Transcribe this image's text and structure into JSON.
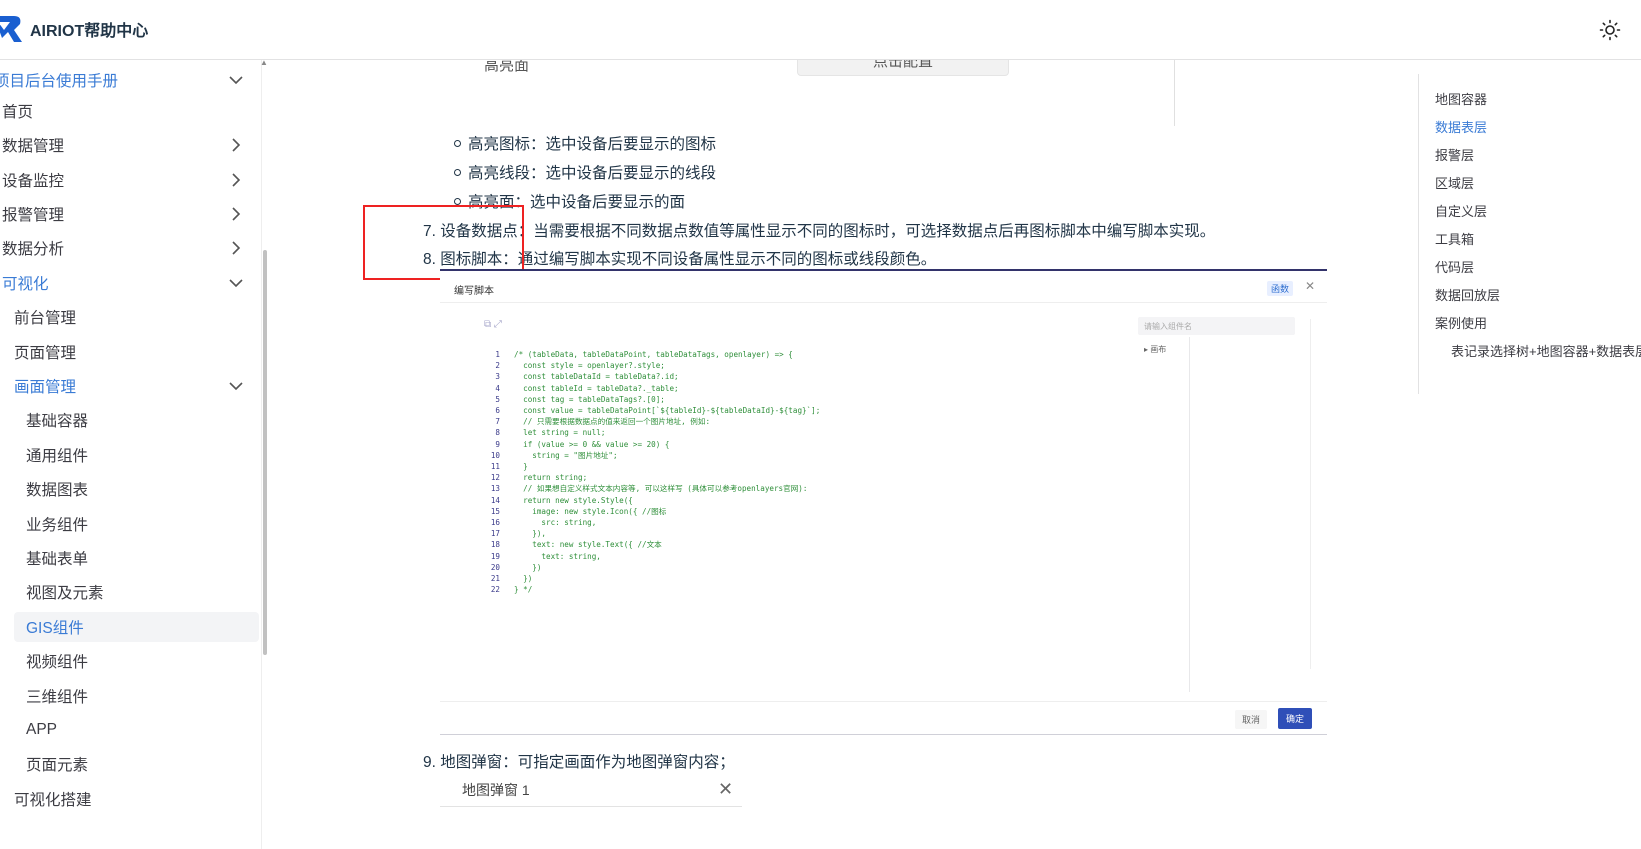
{
  "header": {
    "site_title": "AIRIOT帮助中心",
    "brand_color": "#1a5fd0",
    "theme_icon": "sun-icon"
  },
  "sidebar": {
    "items": [
      {
        "label": "项目后台使用手册",
        "expanded": true,
        "active": true
      },
      {
        "label": "首页"
      },
      {
        "label": "数据管理",
        "expandable": true
      },
      {
        "label": "设备监控",
        "expandable": true
      },
      {
        "label": "报警管理",
        "expandable": true
      },
      {
        "label": "数据分析",
        "expandable": true
      },
      {
        "label": "可视化",
        "expanded": true,
        "active": true
      },
      {
        "label": "前台管理"
      },
      {
        "label": "页面管理"
      },
      {
        "label": "画面管理",
        "expanded": true,
        "active": true
      },
      {
        "label": "基础容器"
      },
      {
        "label": "通用组件"
      },
      {
        "label": "数据图表"
      },
      {
        "label": "业务组件"
      },
      {
        "label": "基础表单"
      },
      {
        "label": "视图及元素"
      },
      {
        "label": "GIS组件",
        "selected": true
      },
      {
        "label": "视频组件"
      },
      {
        "label": "三维组件"
      },
      {
        "label": "APP"
      },
      {
        "label": "页面元素"
      },
      {
        "label": "可视化搭建"
      }
    ]
  },
  "content": {
    "config_label": "高亮面",
    "config_button": "点击配置",
    "bullets": [
      "高亮图标：选中设备后要显示的图标",
      "高亮线段：选中设备后要显示的线段",
      "高亮面：选中设备后要显示的面"
    ],
    "item7": "7. 设备数据点：当需要根据不同数据点数值等属性显示不同的图标时，可选择数据点后再图标脚本中编写脚本实现。",
    "item8": "8. 图标脚本：通过编写脚本实现不同设备属性显示不同的图标或线段颜色。",
    "item9": "9. 地图弹窗：可指定画面作为地图弹窗内容；",
    "dialog": {
      "title": "编写脚本",
      "fn_tag": "函数",
      "search_placeholder": "请输入组件名",
      "tree_item": "画布",
      "cancel": "取消",
      "ok": "确定",
      "code_lines": [
        "/* (tableData, tableDataPoint, tableDataTags, openlayer) => {",
        "  const style = openlayer?.style;",
        "  const tableDataId = tableData?.id;",
        "  const tableId = tableData?._table;",
        "  const tag = tableDataTags?.[0];",
        "  const value = tableDataPoint[`${tableId}-${tableDataId}-${tag}`];",
        "  // 只需要根据数据点的值来返回一个图片地址, 例如:",
        "  let string = null;",
        "  if (value >= 0 && value >= 20) {",
        "    string = \"图片地址\";",
        "  }",
        "  return string;",
        "  // 如果想自定义样式文本内容等, 可以这样写 (具体可以参考openlayers官网):",
        "  return new style.Style({",
        "    image: new style.Icon({ //图标",
        "      src: string,",
        "    }),",
        "    text: new style.Text({ //文本",
        "      text: string,",
        "    })",
        "  })",
        "} */"
      ]
    },
    "popup_label": "地图弹窗 1"
  },
  "outline": {
    "items": [
      {
        "label": "地图容器"
      },
      {
        "label": "数据表层",
        "active": true
      },
      {
        "label": "报警层"
      },
      {
        "label": "区域层"
      },
      {
        "label": "自定义层"
      },
      {
        "label": "工具箱"
      },
      {
        "label": "代码层"
      },
      {
        "label": "数据回放层"
      },
      {
        "label": "案例使用"
      },
      {
        "label": "表记录选择树+地图容器+数据表层",
        "indent": true
      }
    ]
  }
}
